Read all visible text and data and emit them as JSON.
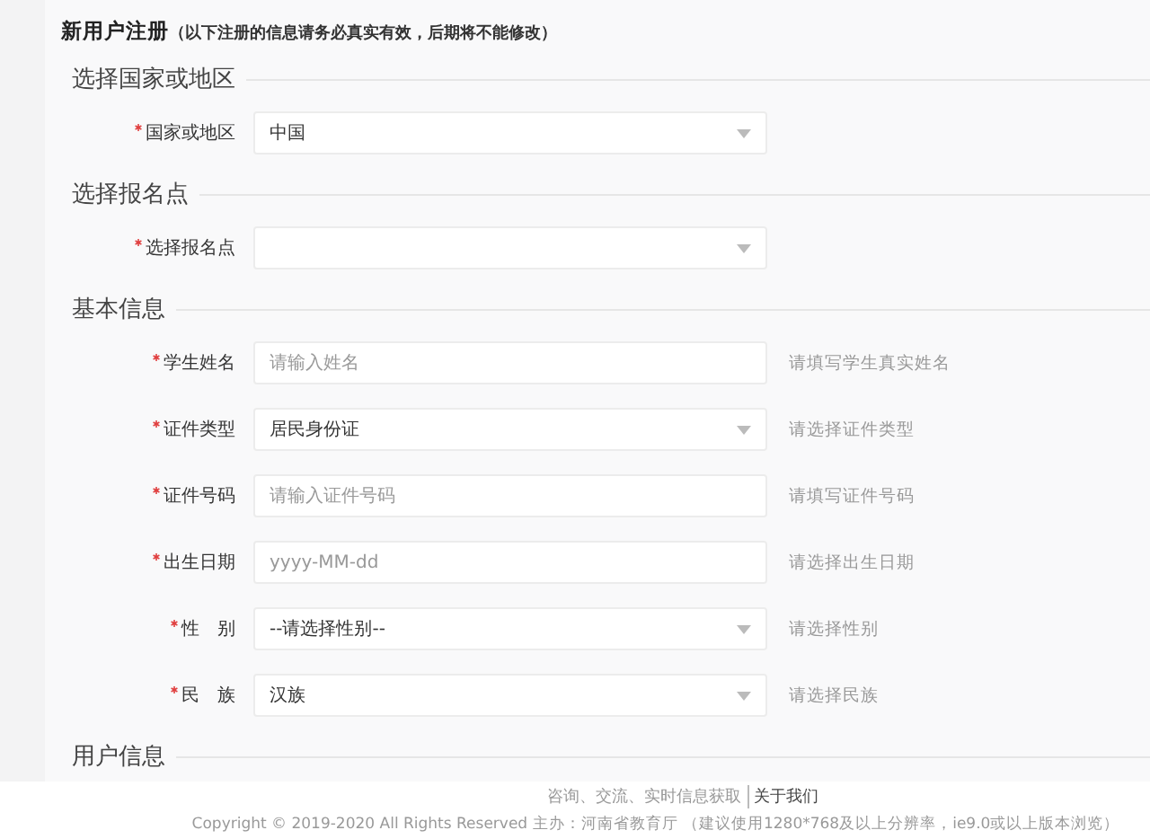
{
  "header": {
    "title": "新用户注册",
    "note": "（以下注册的信息请务必真实有效，后期将不能修改）"
  },
  "sections": [
    {
      "heading": "选择国家或地区",
      "fields": [
        {
          "label": "国家或地区",
          "required": true,
          "kind": "select",
          "value": "中国"
        }
      ]
    },
    {
      "heading": "选择报名点",
      "fields": [
        {
          "label": "选择报名点",
          "required": true,
          "kind": "select"
        }
      ]
    },
    {
      "heading": "基本信息",
      "fields": [
        {
          "label": "学生姓名",
          "required": true,
          "kind": "input",
          "placeholder": "请输入姓名",
          "hint": "请填写学生真实姓名"
        },
        {
          "label": "证件类型",
          "required": true,
          "kind": "select",
          "value": "居民身份证",
          "hint": "请选择证件类型"
        },
        {
          "label": "证件号码",
          "required": true,
          "kind": "input",
          "placeholder": "请输入证件号码",
          "hint": "请填写证件号码"
        },
        {
          "label": "出生日期",
          "required": true,
          "kind": "input",
          "placeholder": "yyyy-MM-dd",
          "hint": "请选择出生日期"
        },
        {
          "label": "性　别",
          "required": true,
          "kind": "select",
          "value": "--请选择性别--",
          "hint": "请选择性别"
        },
        {
          "label": "民　族",
          "required": true,
          "kind": "select",
          "value": "汉族",
          "hint": "请选择民族"
        }
      ]
    },
    {
      "heading": "用户信息"
    }
  ],
  "footer": {
    "links": [
      "咨询、交流、实时信息获取",
      "关于我们"
    ],
    "copyright": "Copyright © 2019-2020 All Rights Reserved 主办：河南省教育厅 （建议使用1280*768及以上分辨率，ie9.0或以上版本浏览）"
  }
}
